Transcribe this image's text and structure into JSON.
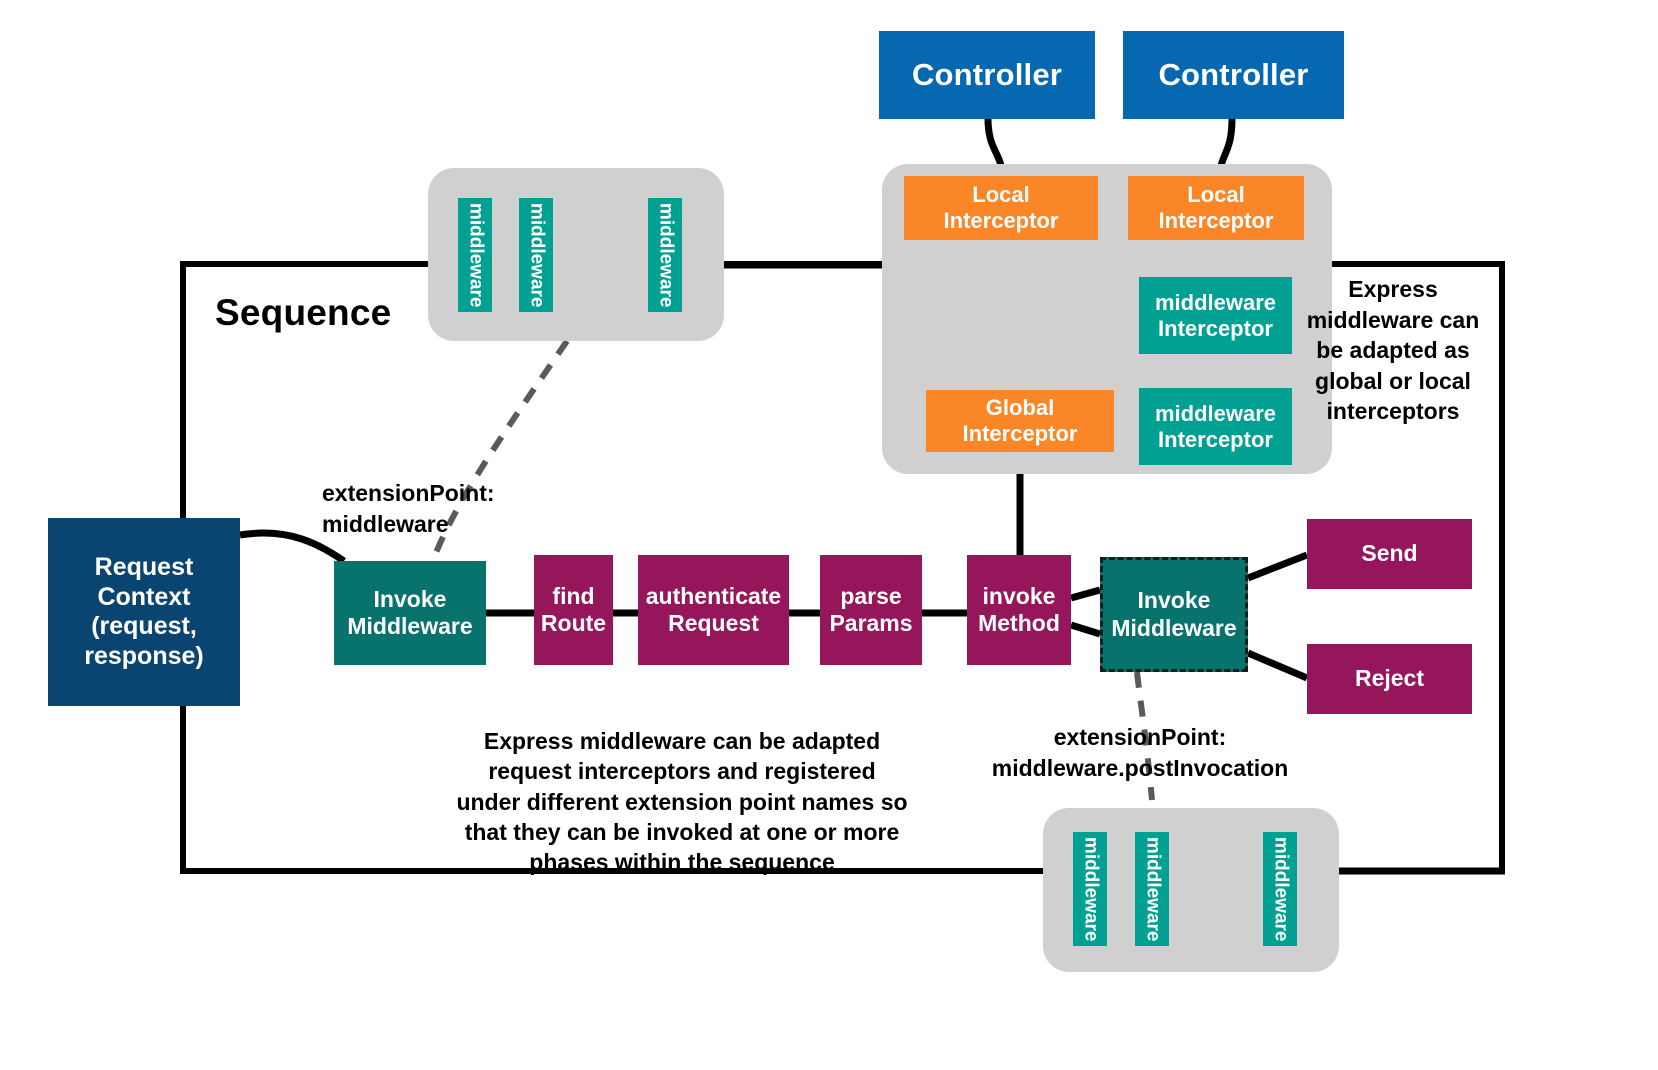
{
  "diagram": {
    "title": "LoopBack 4 Sequence and Interceptors",
    "colors": {
      "controller_blue": "#0568b0",
      "navy": "#0a4470",
      "orange": "#fb8627",
      "teal": "#00a092",
      "dark_teal": "#07736c",
      "magenta": "#96165b",
      "group_grey": "#d0d0d0",
      "edge_black": "#000000",
      "dashed_grey": "#5a5a5a"
    },
    "frame": {
      "label": "Sequence"
    },
    "controllers": [
      {
        "label": "Controller"
      },
      {
        "label": "Controller"
      }
    ],
    "interceptor_group": {
      "items": [
        {
          "label": "Local\nInterceptor",
          "kind": "orange"
        },
        {
          "label": "Local\nInterceptor",
          "kind": "orange"
        },
        {
          "label": "middleware\nInterceptor",
          "kind": "teal"
        },
        {
          "label": "Global\nInterceptor",
          "kind": "orange"
        },
        {
          "label": "middleware\nInterceptor",
          "kind": "teal"
        }
      ]
    },
    "middleware_group_top": {
      "chips": [
        {
          "label": "middleware"
        },
        {
          "label": "middleware"
        },
        {
          "label": "middleware"
        }
      ]
    },
    "middleware_group_bottom": {
      "chips": [
        {
          "label": "middleware"
        },
        {
          "label": "middleware"
        },
        {
          "label": "middleware"
        }
      ]
    },
    "request_context": {
      "label": "Request\nContext\n(request,\nresponse)"
    },
    "sequence_steps": [
      {
        "label": "Invoke\nMiddleware",
        "kind": "dark-teal-solid"
      },
      {
        "label": "find\nRoute",
        "kind": "magenta"
      },
      {
        "label": "authenticate\nRequest",
        "kind": "magenta"
      },
      {
        "label": "parse\nParams",
        "kind": "magenta"
      },
      {
        "label": "invoke\nMethod",
        "kind": "magenta"
      },
      {
        "label": "Invoke\nMiddleware",
        "kind": "dark-teal-dashed"
      }
    ],
    "outcomes": [
      {
        "label": "Send"
      },
      {
        "label": "Reject"
      }
    ],
    "annotations": {
      "extension_point_top": "extensionPoint:\nmiddleware",
      "extension_point_bottom": "extensionPoint:\nmiddleware.postInvocation",
      "note_right": "Express\nmiddleware can\nbe adapted as\nglobal or local\ninterceptors",
      "note_bottom": "Express middleware can be adapted\nrequest interceptors and registered\nunder different extension point names so\nthat they can be invoked at one or more\nphases within the sequence"
    }
  }
}
